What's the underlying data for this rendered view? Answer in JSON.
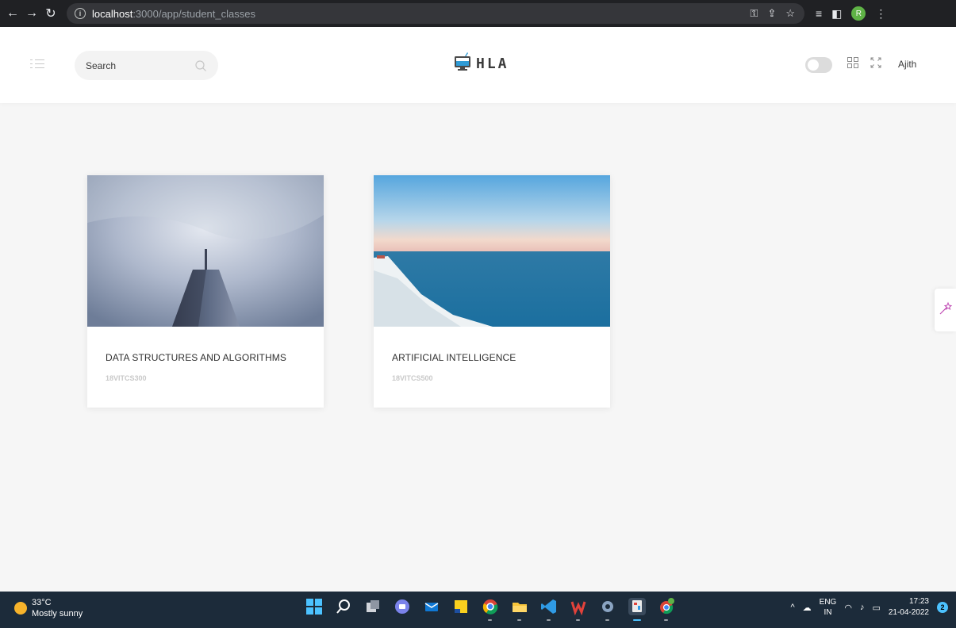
{
  "browser": {
    "url_host": "localhost",
    "url_path": ":3000/app/student_classes",
    "profile_initial": "R"
  },
  "header": {
    "search_placeholder": "Search",
    "logo_text": "HLA",
    "username": "Ajith"
  },
  "classes": [
    {
      "title": "DATA STRUCTURES AND ALGORITHMS",
      "code": "18VITCS300"
    },
    {
      "title": "ARTIFICIAL INTELLIGENCE",
      "code": "18VITCS500"
    }
  ],
  "taskbar": {
    "temperature": "33°C",
    "weather": "Mostly sunny",
    "lang_top": "ENG",
    "lang_bottom": "IN",
    "time": "17:23",
    "date": "21-04-2022",
    "notification_count": "2"
  },
  "colors": {
    "chrome_bg": "#202124",
    "page_bg": "#f6f6f6",
    "taskbar_bg": "#1c2b3a"
  }
}
